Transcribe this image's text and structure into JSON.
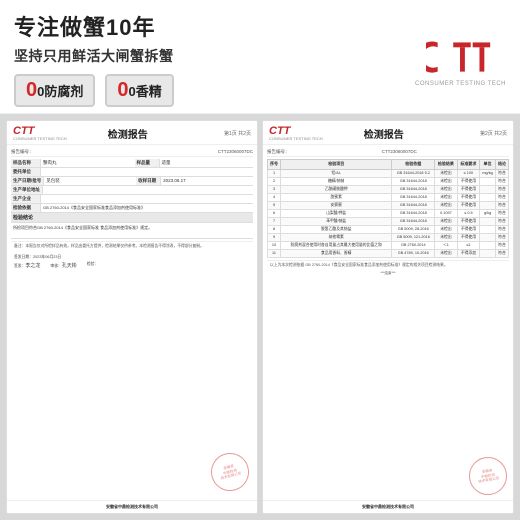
{
  "banner": {
    "title": "专注做蟹10年",
    "subtitle": "坚持只用鲜活大闸蟹拆蟹",
    "badge1": "0防腐剂",
    "badge2": "0香精",
    "logo_text": "CTT",
    "logo_subtitle": "CONSUMER TESTING TECH"
  },
  "report_left": {
    "logo": "CTT",
    "logo_sub": "CONSUMER TESTING TECH",
    "title": "检测报告",
    "page": "第1页 共2页",
    "report_no_label": "报告编号：",
    "report_no": "CTT23060007DC",
    "rows": [
      {
        "label": "样品名称",
        "value": "蟹肉丸"
      },
      {
        "label": "样品数量",
        "value": ""
      },
      {
        "label": "委托单位",
        "value": ""
      },
      {
        "label": "生产日期/批号",
        "value": ""
      },
      {
        "label": "生产单位地址",
        "value": ""
      },
      {
        "label": "生产企业",
        "value": ""
      },
      {
        "label": "检验依据",
        "value": ""
      },
      {
        "label": "检验结论",
        "value": ""
      }
    ],
    "section_conclusion": "检验结论",
    "conclusion_text": "所检项目符合GB 2760-2014《食品安全国家标准食品添加剂使用标准》规定。",
    "footer_note": "备注：本报告仅对所检样品有效，样品由委托方提供，检测结果仅供参考。",
    "company": "安徽省中鼎检测技术有限公司",
    "sign_items": [
      "签发：",
      "审核：",
      "检验："
    ],
    "seal_text": "安徽省\n中鼎检测\n技术有限公司"
  },
  "report_right": {
    "logo": "CTT",
    "logo_sub": "CONSUMER TESTING TECH",
    "title": "检测报告",
    "page": "第2页 共2页",
    "report_no": "CTT23060007DC",
    "columns": [
      "序号",
      "检验项目",
      "检验依据",
      "检验结果",
      "标准要求",
      "单位",
      "结论"
    ],
    "rows": [
      [
        "1",
        "铝/AL",
        "GB 31644-2018 5.2",
        "未检出",
        "≤ 100",
        "mg/kg",
        "符合"
      ],
      [
        "2",
        "糖精/钠钠",
        "GB 31644-2018",
        "未检出",
        "不得使用",
        "",
        "符合"
      ],
      [
        "3",
        "乙酰磺胺酸钾",
        "GB 31644-2018",
        "未检出",
        "不得使用",
        "",
        "符合"
      ],
      [
        "4",
        "甜蜜素",
        "GB 31644-2018",
        "未检出",
        "不得使用",
        "",
        "符合"
      ],
      [
        "5",
        "安赛蜜",
        "GB 31644-2018",
        "未检出",
        "不得使用",
        "",
        "符合"
      ],
      [
        "6",
        "山梨酸/钾盐",
        "GB 31644-2018",
        "0.1097",
        "≤ 0.5",
        "g/kg",
        "符合"
      ],
      [
        "7",
        "苯甲酸/钠盐",
        "GB 31644-2018",
        "未检出",
        "不得使用",
        "",
        "符合"
      ],
      [
        "8",
        "脱氢乙酸及其钠盐",
        "GB 5009, 28-2016",
        "未检出",
        "不得使用",
        "",
        "符合"
      ],
      [
        "9",
        "纳他霉素",
        "GB 5009, 121-2016",
        "未检出",
        "不得使用",
        "",
        "符合"
      ],
      [
        "10",
        "防腐剂混合使用时各自用量占其最大使用量的比值之和",
        "GB 2760-2014",
        "＜1",
        "≤1",
        "",
        "符合"
      ],
      [
        "11",
        "食品用香料、香精",
        "GB 4789, 10-2016",
        "未检出",
        "不得添加",
        "",
        "符合"
      ]
    ],
    "footer_note": "以上为本次检测依据 GB 2760-2014《食品安全国家标准食品添加剂使用标准》规定的相关项目检测结果。",
    "company": "安徽省中鼎检测技术有限公司",
    "seal_text": "安徽省\n中鼎检测\n技术有限公司"
  }
}
